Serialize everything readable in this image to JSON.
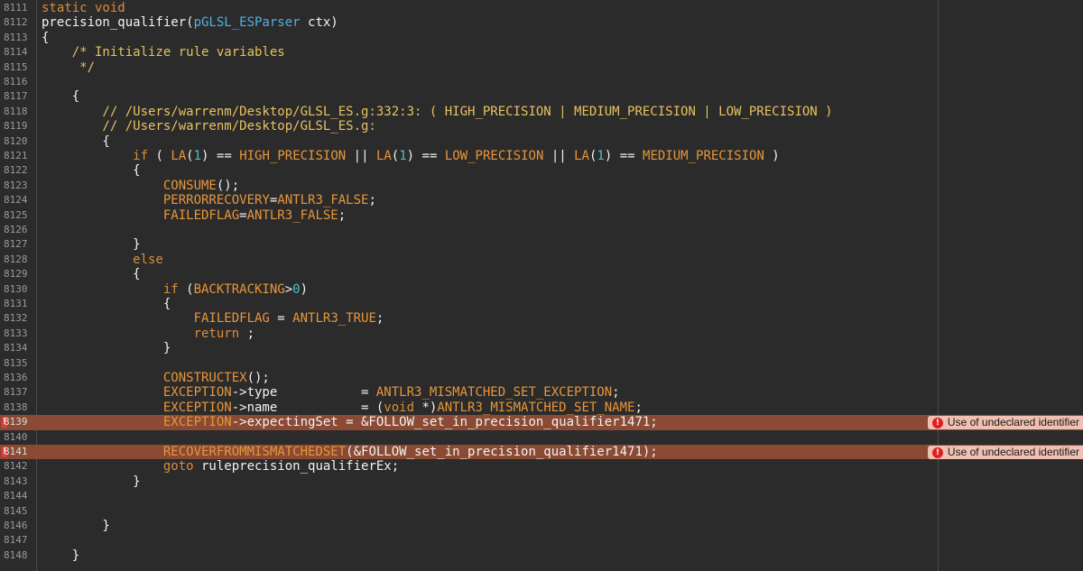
{
  "editor": {
    "lines": [
      {
        "num": "8111",
        "tokens": [
          [
            "kw",
            "static void"
          ]
        ]
      },
      {
        "num": "8112",
        "tokens": [
          [
            "plain",
            "precision_qualifier("
          ],
          [
            "type",
            "pGLSL_ESParser"
          ],
          [
            "plain",
            " ctx)"
          ]
        ]
      },
      {
        "num": "8113",
        "tokens": [
          [
            "plain",
            "{"
          ]
        ]
      },
      {
        "num": "8114",
        "tokens": [
          [
            "cm",
            "    /* Initialize rule variables"
          ]
        ]
      },
      {
        "num": "8115",
        "tokens": [
          [
            "cm",
            "     */"
          ]
        ]
      },
      {
        "num": "8116",
        "tokens": []
      },
      {
        "num": "8117",
        "tokens": [
          [
            "plain",
            "    {"
          ]
        ]
      },
      {
        "num": "8118",
        "tokens": [
          [
            "cm",
            "        // /Users/warrenm/Desktop/GLSL_ES.g:332:3: ( HIGH_PRECISION | MEDIUM_PRECISION | LOW_PRECISION )"
          ]
        ]
      },
      {
        "num": "8119",
        "tokens": [
          [
            "cm",
            "        // /Users/warrenm/Desktop/GLSL_ES.g:"
          ]
        ]
      },
      {
        "num": "8120",
        "tokens": [
          [
            "plain",
            "        {"
          ]
        ]
      },
      {
        "num": "8121",
        "tokens": [
          [
            "kw",
            "            if"
          ],
          [
            "plain",
            " ( "
          ],
          [
            "mac",
            "LA"
          ],
          [
            "plain",
            "("
          ],
          [
            "num",
            "1"
          ],
          [
            "plain",
            ") == "
          ],
          [
            "mac",
            "HIGH_PRECISION"
          ],
          [
            "plain",
            " || "
          ],
          [
            "mac",
            "LA"
          ],
          [
            "plain",
            "("
          ],
          [
            "num",
            "1"
          ],
          [
            "plain",
            ") == "
          ],
          [
            "mac",
            "LOW_PRECISION"
          ],
          [
            "plain",
            " || "
          ],
          [
            "mac",
            "LA"
          ],
          [
            "plain",
            "("
          ],
          [
            "num",
            "1"
          ],
          [
            "plain",
            ") == "
          ],
          [
            "mac",
            "MEDIUM_PRECISION"
          ],
          [
            "plain",
            " )"
          ]
        ]
      },
      {
        "num": "8122",
        "tokens": [
          [
            "plain",
            "            {"
          ]
        ]
      },
      {
        "num": "8123",
        "tokens": [
          [
            "mac",
            "                CONSUME"
          ],
          [
            "plain",
            "();"
          ]
        ]
      },
      {
        "num": "8124",
        "tokens": [
          [
            "mac",
            "                PERRORRECOVERY"
          ],
          [
            "plain",
            "="
          ],
          [
            "mac",
            "ANTLR3_FALSE"
          ],
          [
            "plain",
            ";"
          ]
        ]
      },
      {
        "num": "8125",
        "tokens": [
          [
            "mac",
            "                FAILEDFLAG"
          ],
          [
            "plain",
            "="
          ],
          [
            "mac",
            "ANTLR3_FALSE"
          ],
          [
            "plain",
            ";"
          ]
        ]
      },
      {
        "num": "8126",
        "tokens": []
      },
      {
        "num": "8127",
        "tokens": [
          [
            "plain",
            "            }"
          ]
        ]
      },
      {
        "num": "8128",
        "tokens": [
          [
            "kw",
            "            else"
          ]
        ]
      },
      {
        "num": "8129",
        "tokens": [
          [
            "plain",
            "            {"
          ]
        ]
      },
      {
        "num": "8130",
        "tokens": [
          [
            "kw",
            "                if"
          ],
          [
            "plain",
            " ("
          ],
          [
            "mac",
            "BACKTRACKING"
          ],
          [
            "plain",
            ">"
          ],
          [
            "num",
            "0"
          ],
          [
            "plain",
            ")"
          ]
        ]
      },
      {
        "num": "8131",
        "tokens": [
          [
            "plain",
            "                {"
          ]
        ]
      },
      {
        "num": "8132",
        "tokens": [
          [
            "mac",
            "                    FAILEDFLAG"
          ],
          [
            "plain",
            " = "
          ],
          [
            "mac",
            "ANTLR3_TRUE"
          ],
          [
            "plain",
            ";"
          ]
        ]
      },
      {
        "num": "8133",
        "tokens": [
          [
            "kw",
            "                    return"
          ],
          [
            "plain",
            " ;"
          ]
        ]
      },
      {
        "num": "8134",
        "tokens": [
          [
            "plain",
            "                }"
          ]
        ]
      },
      {
        "num": "8135",
        "tokens": []
      },
      {
        "num": "8136",
        "tokens": [
          [
            "mac",
            "                CONSTRUCTEX"
          ],
          [
            "plain",
            "();"
          ]
        ]
      },
      {
        "num": "8137",
        "tokens": [
          [
            "mac",
            "                EXCEPTION"
          ],
          [
            "plain",
            "->type           = "
          ],
          [
            "mac",
            "ANTLR3_MISMATCHED_SET_EXCEPTION"
          ],
          [
            "plain",
            ";"
          ]
        ]
      },
      {
        "num": "8138",
        "tokens": [
          [
            "mac",
            "                EXCEPTION"
          ],
          [
            "plain",
            "->name           = ("
          ],
          [
            "kw",
            "void"
          ],
          [
            "plain",
            " *)"
          ],
          [
            "mac",
            "ANTLR3_MISMATCHED_SET_NAME"
          ],
          [
            "plain",
            ";"
          ]
        ]
      },
      {
        "num": "8139",
        "error": true,
        "tokens": [
          [
            "mac",
            "                EXCEPTION"
          ],
          [
            "plain",
            "->expectingSet = &FOLLOW_set_in_precision_qualifier1471;"
          ]
        ]
      },
      {
        "num": "8140",
        "tokens": []
      },
      {
        "num": "8141",
        "error": true,
        "tokens": [
          [
            "mac",
            "                RECOVERFROMMISMATCHEDSET"
          ],
          [
            "plain",
            "(&FOLLOW_set_in_precision_qualifier1471);"
          ]
        ]
      },
      {
        "num": "8142",
        "tokens": [
          [
            "kw",
            "                goto"
          ],
          [
            "plain",
            " ruleprecision_qualifierEx;"
          ]
        ]
      },
      {
        "num": "8143",
        "tokens": [
          [
            "plain",
            "            }"
          ]
        ]
      },
      {
        "num": "8144",
        "tokens": []
      },
      {
        "num": "8145",
        "tokens": []
      },
      {
        "num": "8146",
        "tokens": [
          [
            "plain",
            "        }"
          ]
        ]
      },
      {
        "num": "8147",
        "tokens": []
      },
      {
        "num": "8148",
        "tokens": [
          [
            "plain",
            "    }"
          ]
        ]
      }
    ],
    "error_message": "Use of undeclared identifier",
    "error_gutter_mark": "!",
    "error_icon": "error-circle-icon",
    "colors": {
      "background": "#2b2b2b",
      "keyword": "#d98d3a",
      "comment": "#e8c25f",
      "macro": "#e8963a",
      "number": "#4fc1c1",
      "error_line": "#8a4a34",
      "error_badge": "#f0c0b2"
    }
  }
}
